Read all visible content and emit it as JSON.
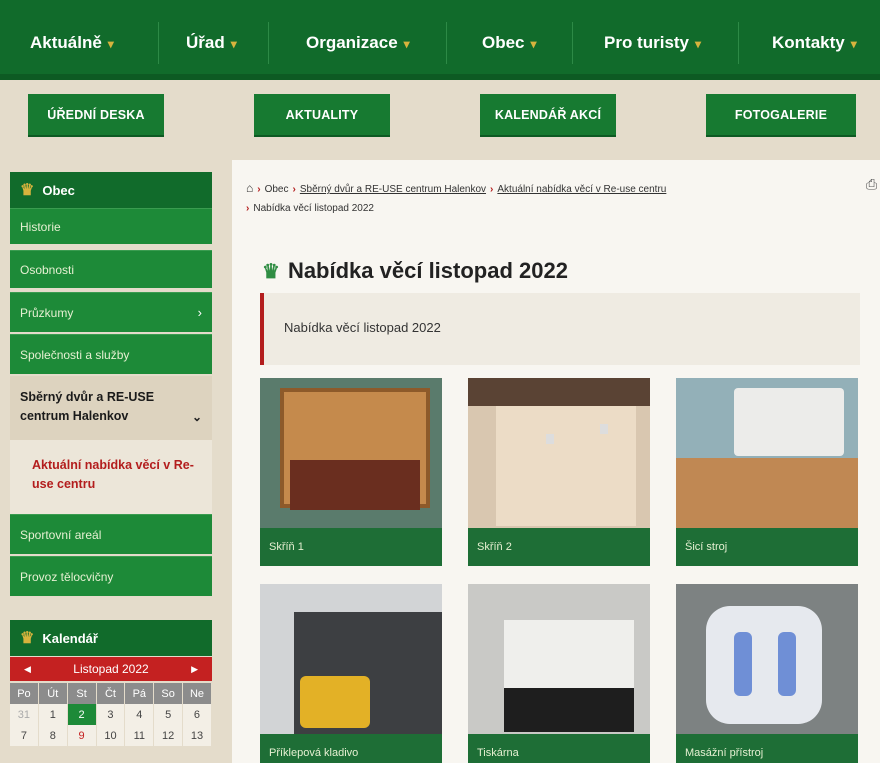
{
  "topnav": {
    "items": [
      {
        "label": "Aktuálně"
      },
      {
        "label": "Úřad"
      },
      {
        "label": "Organizace"
      },
      {
        "label": "Obec"
      },
      {
        "label": "Pro turisty"
      },
      {
        "label": "Kontakty"
      }
    ],
    "caret": "⌄"
  },
  "subnav": {
    "buttons": [
      {
        "label": "ÚŘEDNÍ DESKA"
      },
      {
        "label": "AKTUALITY"
      },
      {
        "label": "KALENDÁŘ AKCÍ"
      },
      {
        "label": "FOTOGALERIE"
      }
    ]
  },
  "sidebar": {
    "title": "Obec",
    "items": [
      {
        "label": "Historie"
      },
      {
        "label": "Osobnosti"
      },
      {
        "label": "Průzkumy"
      },
      {
        "label": "Společnosti a služby"
      }
    ],
    "active": "Sběrný dvůr a RE-USE centrum Halenkov",
    "sub": "Aktuální nabídka věcí v Re-use centru",
    "items2": [
      {
        "label": "Sportovní areál"
      },
      {
        "label": "Provoz tělocvičny"
      }
    ]
  },
  "calendar": {
    "title": "Kalendář",
    "month": "Listopad 2022",
    "weekdays": [
      "Po",
      "Út",
      "St",
      "Čt",
      "Pá",
      "So",
      "Ne"
    ],
    "row1": [
      "31",
      "1",
      "2",
      "3",
      "4",
      "5",
      "6"
    ],
    "row2": [
      "7",
      "8",
      "9",
      "10",
      "11",
      "12",
      "13"
    ]
  },
  "breadcrumb": {
    "items": [
      {
        "label": "Obec"
      },
      {
        "label": "Sběrný dvůr a RE-USE centrum Halenkov"
      },
      {
        "label": "Aktuální nabídka věcí v Re-use centru"
      },
      {
        "label": "Nabídka věcí listopad 2022"
      }
    ]
  },
  "page": {
    "title": "Nabídka věcí listopad 2022",
    "intro": "Nabídka věcí listopad 2022"
  },
  "gallery": [
    {
      "caption": "Skříň 1"
    },
    {
      "caption": "Skříň 2"
    },
    {
      "caption": "Šicí stroj"
    },
    {
      "caption": "Příklepová kladivo"
    },
    {
      "caption": "Tiskárna"
    },
    {
      "caption": "Masážní přístroj"
    }
  ],
  "colors": {
    "primary_green": "#116b2b",
    "accent_red": "#c42121",
    "beige": "#e4dccb"
  }
}
